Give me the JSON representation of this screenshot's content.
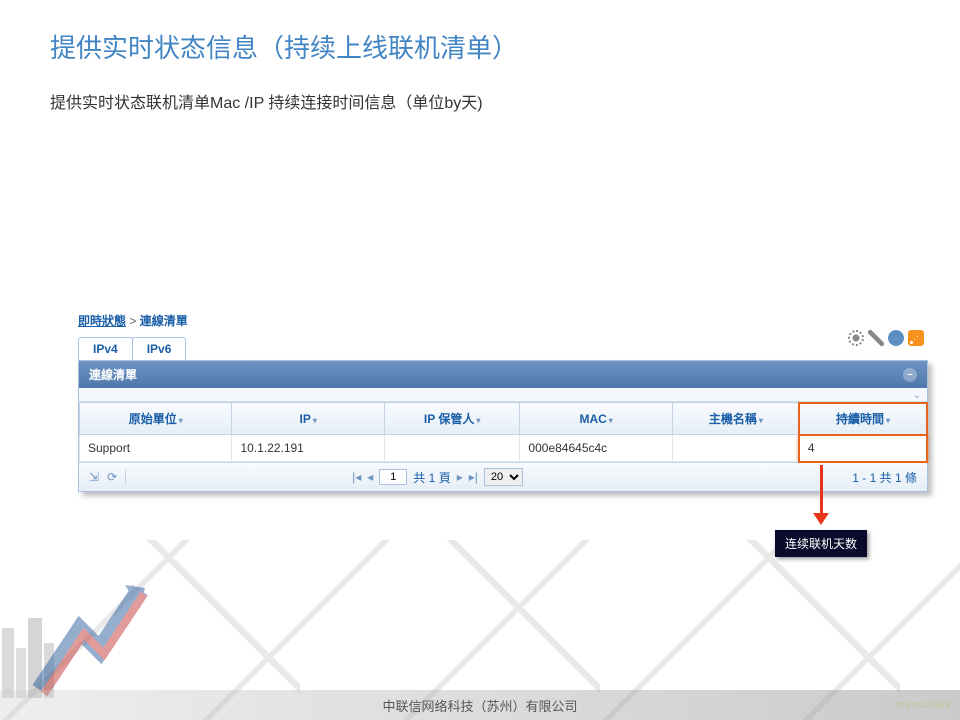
{
  "title": "提供实时状态信息（持续上线联机清单）",
  "subtitle": "提供实时状态联机清单Mac /IP 持续连接时间信息（单位by天)",
  "breadcrumb": {
    "link": "即時狀態",
    "sep": ">",
    "current": "連線清單"
  },
  "tabs": {
    "ipv4": "IPv4",
    "ipv6": "IPv6"
  },
  "panel": {
    "header": "連線清單"
  },
  "columns": {
    "org": "原始單位",
    "ip": "IP",
    "custodian": "IP 保管人",
    "mac": "MAC",
    "hostname": "主機名稱",
    "duration": "持續時間"
  },
  "rows": [
    {
      "org": "Support",
      "ip": "10.1.22.191",
      "custodian": "",
      "mac": "000e84645c4c",
      "hostname": "",
      "duration": "4"
    }
  ],
  "pager": {
    "page_current": "1",
    "page_label_prefix": "共",
    "page_label_suffix": "頁",
    "page_total": "1",
    "page_size": "20",
    "display": "1 - 1 共 1 條"
  },
  "callout": "连续联机天数",
  "footer": {
    "company": "中联信网络科技（苏州）有限公司",
    "logo": "mercuries"
  }
}
